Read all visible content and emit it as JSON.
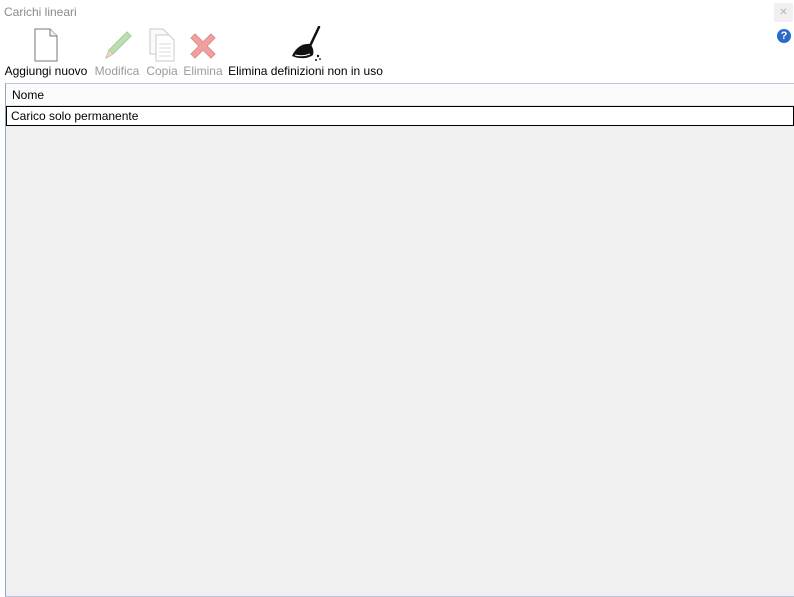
{
  "window": {
    "title": "Carichi lineari"
  },
  "toolbar": {
    "add_label": "Aggiungi nuovo",
    "edit_label": "Modifica",
    "copy_label": "Copia",
    "delete_label": "Elimina",
    "purge_label": "Elimina definizioni non in uso",
    "help_glyph": "?"
  },
  "grid": {
    "columns": [
      "Nome"
    ],
    "rows": [
      {
        "nome": "Carico solo permanente"
      }
    ]
  }
}
